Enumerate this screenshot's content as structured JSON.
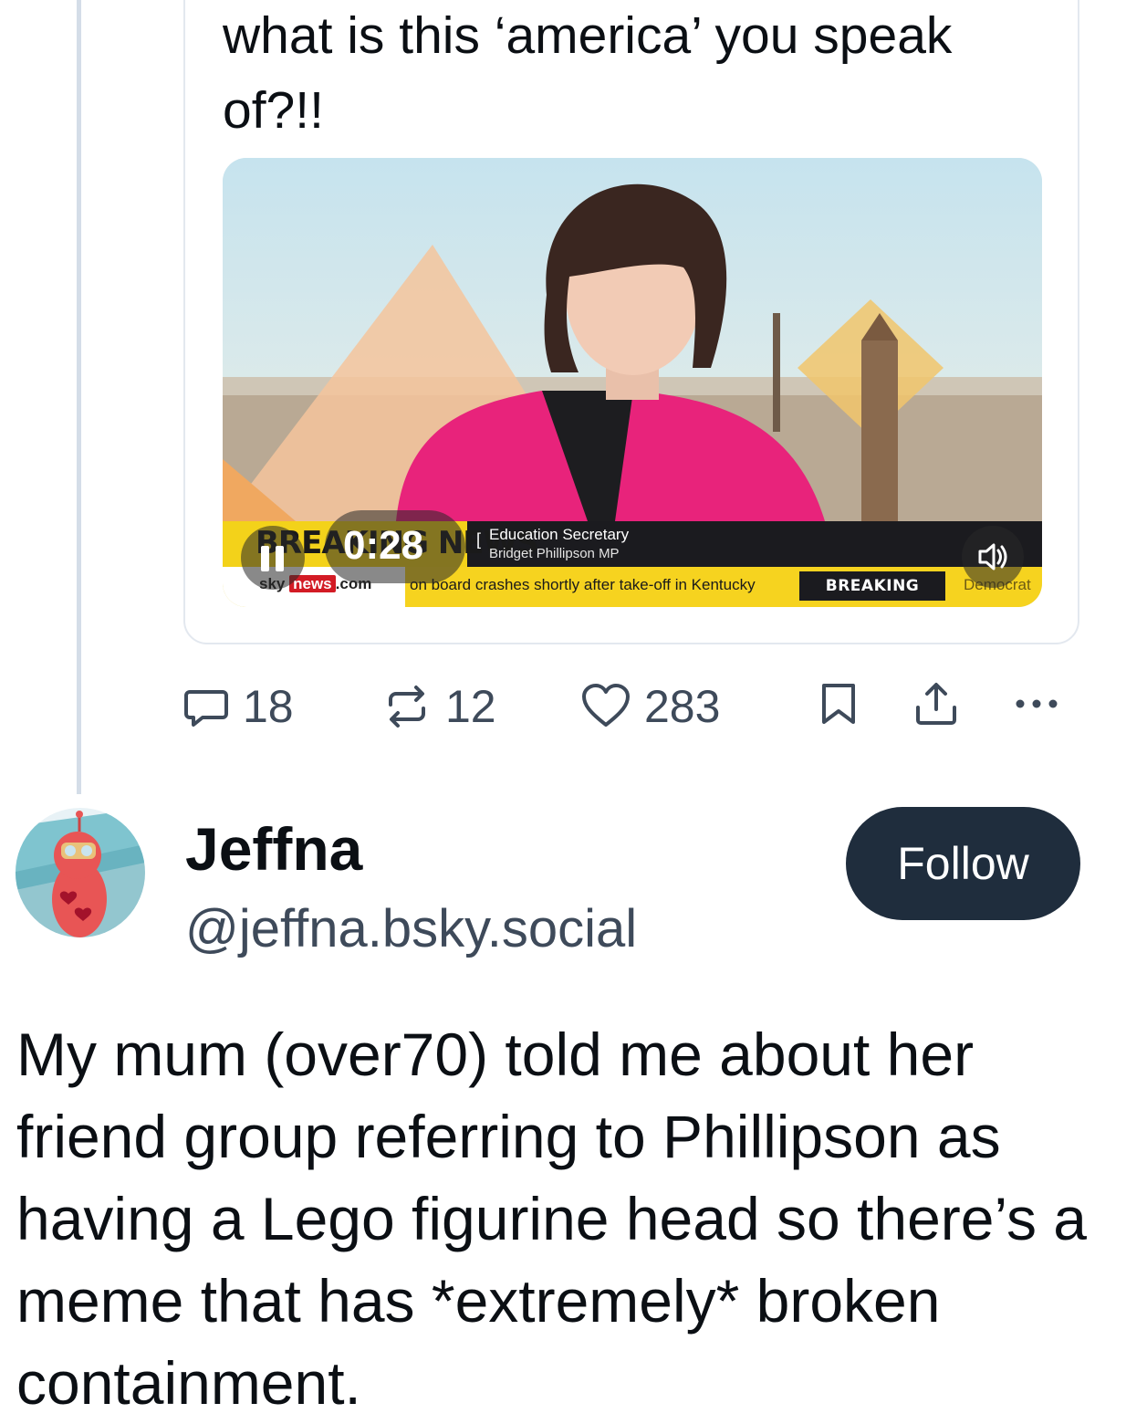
{
  "quoted_post": {
    "text": "what is this ‘america’ you speak of?!!",
    "video": {
      "time": "0:28",
      "lower_third": {
        "banner_left": "BREAKING NEWS",
        "caption_title": "Education Secretary",
        "caption_subtitle": "Bridget Phillipson MP",
        "channel_logo": "sky",
        "channel_logo_news": "news",
        "channel_logo_suffix": ".com",
        "ticker": "on board crashes shortly after take-off in Kentucky",
        "tag": "BREAKING NEWS",
        "tail": "Democrat"
      },
      "icons": [
        "pause-icon",
        "speaker-icon"
      ],
      "colors": {
        "pink_jacket": "#e8237b",
        "ticker_yellow": "#f3d21a"
      }
    }
  },
  "actions": {
    "replies": "18",
    "reposts": "12",
    "likes": "283",
    "icons": [
      "reply-icon",
      "repost-icon",
      "like-icon",
      "bookmark-icon",
      "share-icon",
      "more-icon"
    ]
  },
  "author": {
    "display_name": "Jeffna",
    "handle": "@jeffna.bsky.social",
    "follow_label": "Follow"
  },
  "post": {
    "text": "My mum (over70) told me about her friend group referring to Phillipson as having a Lego figurine head so there’s a meme that has *extremely* broken containment."
  },
  "colors": {
    "follow_button": "#1f2d3d",
    "muted_text": "#3e4a5a",
    "thread_line": "#d4dde8"
  }
}
